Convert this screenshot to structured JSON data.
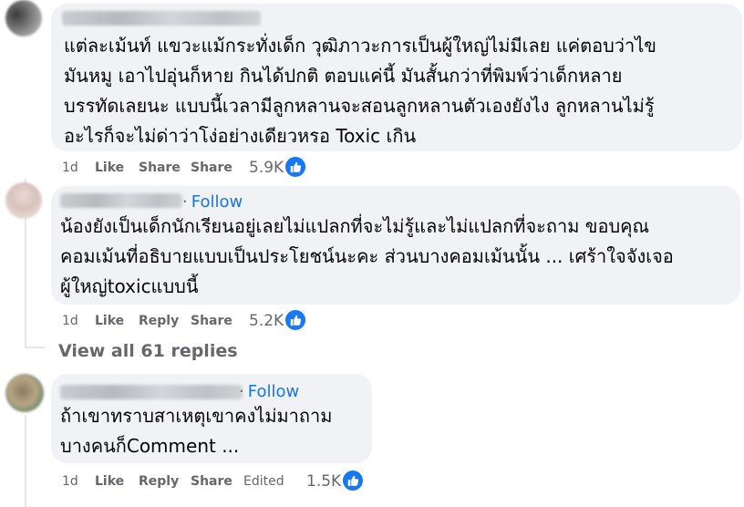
{
  "comments": [
    {
      "text_lines": [
        "แต่ละเม้นท์ แขวะแม้กระทั่งเด็ก วุฒิภาวะการเป็นผู้ใหญ่ไม่มีเลย แค่ตอบว่าไข",
        "มันหมู เอาไปอุ่นก็หาย กินได้ปกติ ตอบแค่นี้ มันสั้นกว่าที่พิมพ์ว่าเด็กหลาย",
        "บรรทัดเลยนะ แบบนี้เวลามีลูกหลานจะสอนลูกหลานตัวเองยังไง ลูกหลานไม่รู้",
        "อะไรก็จะไม่ด่าว่าโง่อย่างเดียวหรอ Toxic เกิน"
      ],
      "time": "1d",
      "like_label": "Like",
      "reply_label": "Share",
      "share_label": "Share",
      "reaction_count": "5.9K",
      "reaction_icon": "like-icon"
    },
    {
      "follow_label": "Follow",
      "text_lines": [
        "น้องยังเป็นเด็กนักเรียนอยู่เลยไม่แปลกที่จะไม่รู้และไม่แปลกที่จะถาม ขอบคุณ",
        "คอมเม้นที่อธิบายแบบเป็นประโยชน์นะคะ ส่วนบางคอมเม้นนั้น ... เศร้าใจจังเจอ",
        "ผู้ใหญ่toxicแบบนี้"
      ],
      "time": "1d",
      "like_label": "Like",
      "reply_label": "Reply",
      "share_label": "Share",
      "reaction_count": "5.2K",
      "reaction_icon": "like-icon"
    },
    {
      "follow_label": "Follow",
      "text_lines": [
        "ถ้าเขาทราบสาเหตุเขาคงไม่มาถาม",
        "บางคนก็Comment ..."
      ],
      "time": "1d",
      "like_label": "Like",
      "reply_label": "Reply",
      "share_label": "Share",
      "edited_label": "Edited",
      "reaction_count": "1.5K",
      "reaction_icon": "like-icon"
    }
  ],
  "view_all_replies": "View all 61 replies",
  "colors": {
    "bubble": "#f0f2f5",
    "link": "#1b74e4",
    "meta": "#65676b",
    "like": "#1877f2"
  }
}
